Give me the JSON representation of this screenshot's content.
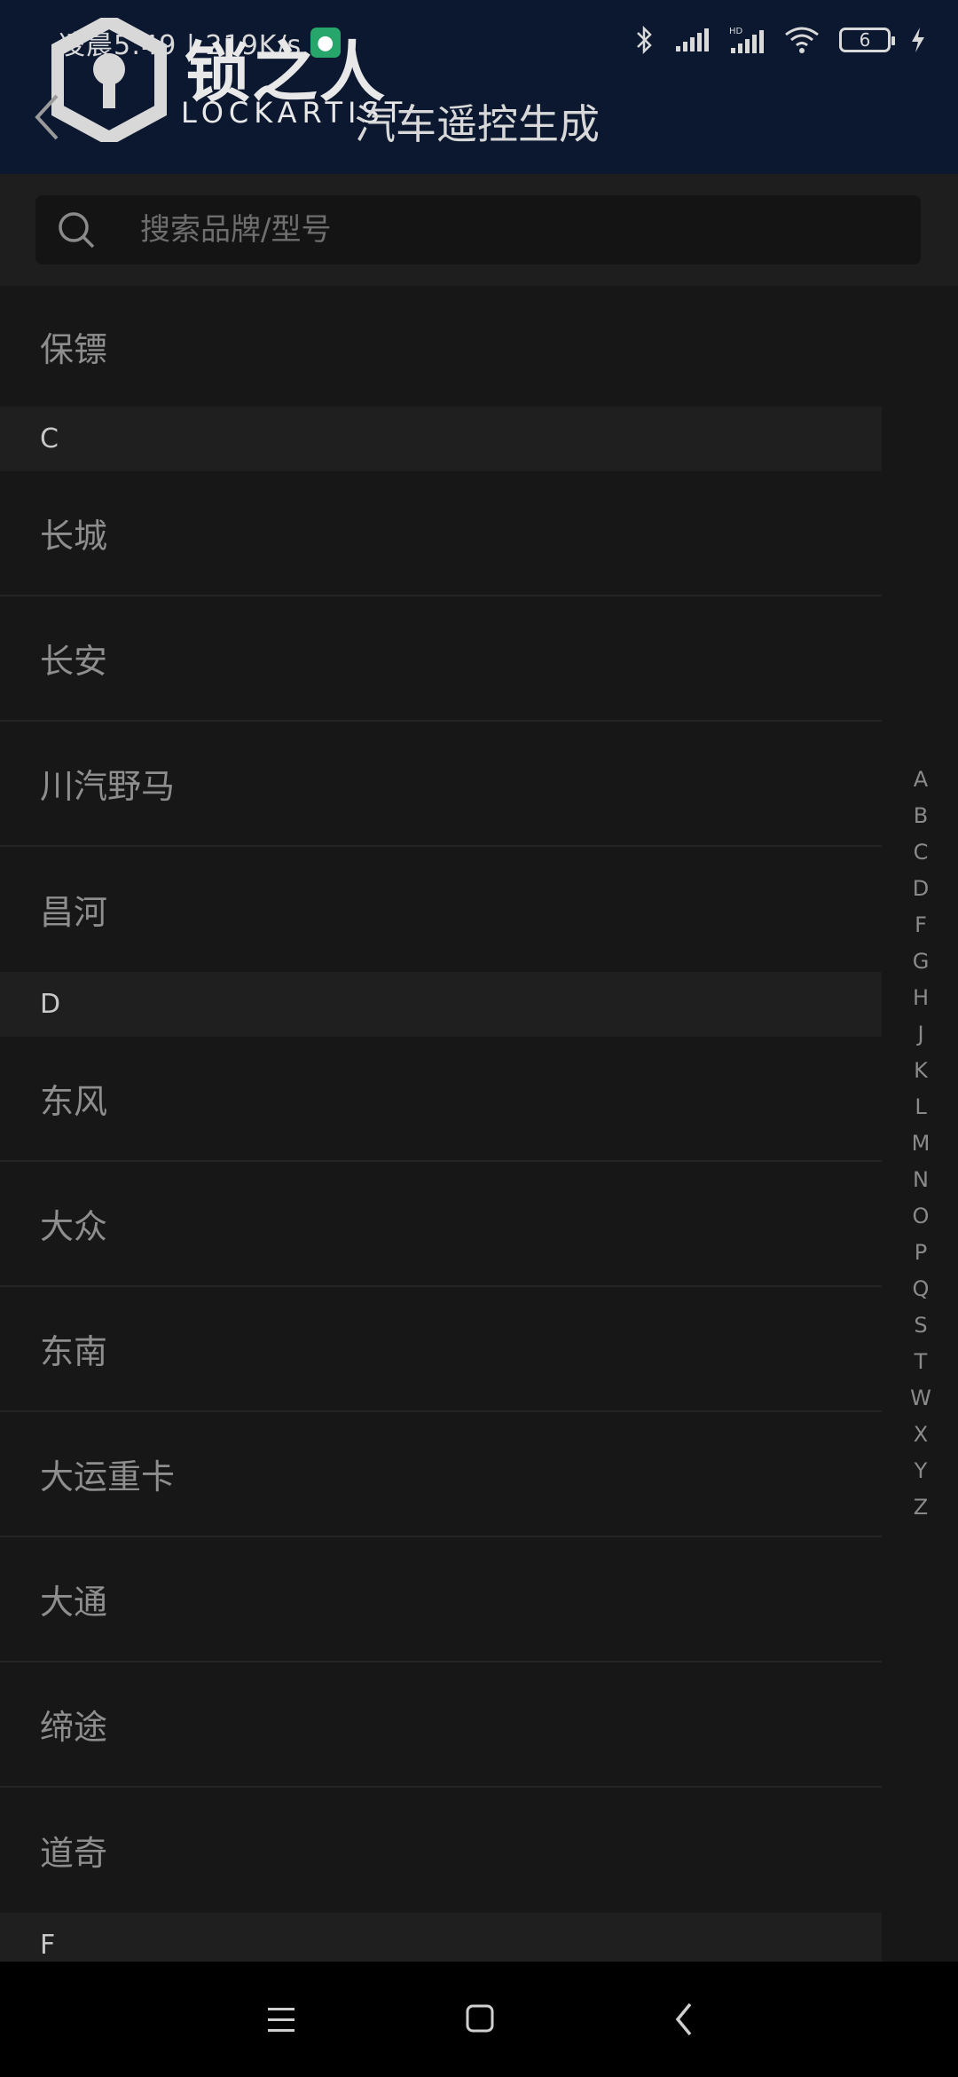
{
  "status_bar": {
    "time_text": "凌晨5:49 | 219K/s",
    "battery": "6"
  },
  "logo": {
    "cn": "锁之人",
    "en": "LOCKARTIST"
  },
  "header": {
    "title": "汽车遥控生成"
  },
  "search": {
    "placeholder": "搜索品牌/型号"
  },
  "list": {
    "rows": [
      {
        "type": "item",
        "label": "保镖"
      },
      {
        "type": "section",
        "label": "C"
      },
      {
        "type": "item",
        "label": "长城"
      },
      {
        "type": "item",
        "label": "长安"
      },
      {
        "type": "item",
        "label": "川汽野马"
      },
      {
        "type": "item",
        "label": "昌河"
      },
      {
        "type": "section",
        "label": "D"
      },
      {
        "type": "item",
        "label": "东风"
      },
      {
        "type": "item",
        "label": "大众"
      },
      {
        "type": "item",
        "label": "东南"
      },
      {
        "type": "item",
        "label": "大运重卡"
      },
      {
        "type": "item",
        "label": "大通"
      },
      {
        "type": "item",
        "label": "缔途"
      },
      {
        "type": "item",
        "label": "道奇"
      },
      {
        "type": "section",
        "label": "F"
      }
    ]
  },
  "index_letters": [
    "A",
    "B",
    "C",
    "D",
    "F",
    "G",
    "H",
    "J",
    "K",
    "L",
    "M",
    "N",
    "O",
    "P",
    "Q",
    "S",
    "T",
    "W",
    "X",
    "Y",
    "Z"
  ],
  "colors": {
    "header_bg": "#0b1830",
    "page_bg": "#171717",
    "section_bg": "#1f1f1f"
  }
}
